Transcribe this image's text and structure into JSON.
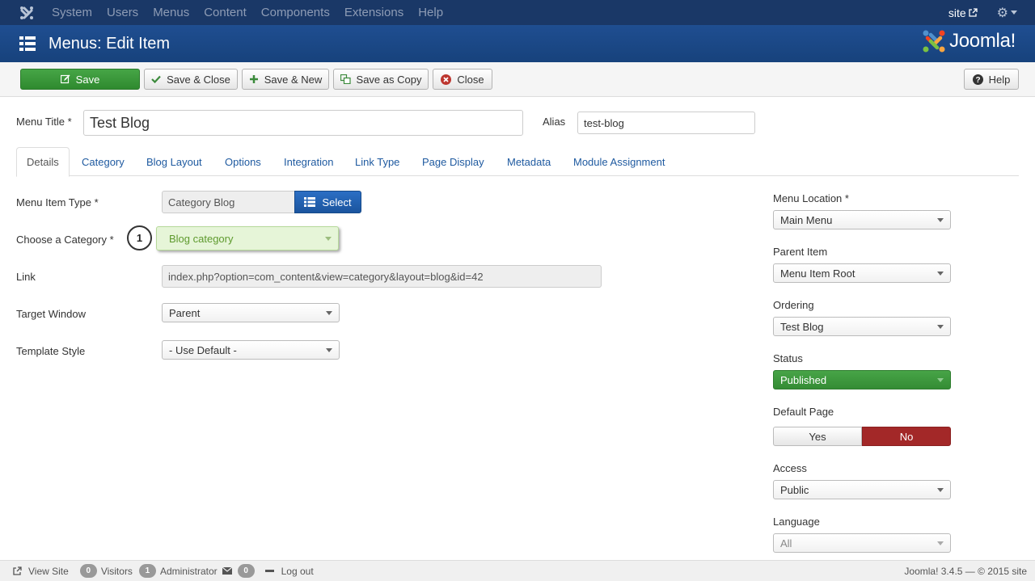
{
  "topnav": {
    "menu": [
      "System",
      "Users",
      "Menus",
      "Content",
      "Components",
      "Extensions",
      "Help"
    ],
    "site_label": "site"
  },
  "header": {
    "title": "Menus: Edit Item",
    "brand": "Joomla!"
  },
  "toolbar": {
    "save": "Save",
    "save_close": "Save & Close",
    "save_new": "Save & New",
    "save_copy": "Save as Copy",
    "close": "Close",
    "help": "Help"
  },
  "titlerow": {
    "menu_title_label": "Menu Title *",
    "menu_title_value": "Test Blog",
    "alias_label": "Alias",
    "alias_value": "test-blog"
  },
  "tabs": [
    "Details",
    "Category",
    "Blog Layout",
    "Options",
    "Integration",
    "Link Type",
    "Page Display",
    "Metadata",
    "Module Assignment"
  ],
  "details": {
    "menu_item_type_label": "Menu Item Type *",
    "menu_item_type_value": "Category Blog",
    "select_button": "Select",
    "category_label": "Choose a Category *",
    "category_value": "Blog category",
    "marker": "1",
    "link_label": "Link",
    "link_value": "index.php?option=com_content&view=category&layout=blog&id=42",
    "target_label": "Target Window",
    "target_value": "Parent",
    "template_label": "Template Style",
    "template_value": "- Use Default -"
  },
  "sidebar": {
    "menu_location_label": "Menu Location *",
    "menu_location_value": "Main Menu",
    "parent_label": "Parent Item",
    "parent_value": "Menu Item Root",
    "ordering_label": "Ordering",
    "ordering_value": "Test Blog",
    "status_label": "Status",
    "status_value": "Published",
    "default_label": "Default Page",
    "default_yes": "Yes",
    "default_no": "No",
    "access_label": "Access",
    "access_value": "Public",
    "language_label": "Language",
    "language_value": "All"
  },
  "footer": {
    "view_site": "View Site",
    "visitors_count": "0",
    "visitors_label": "Visitors",
    "admin_count": "1",
    "admin_label": "Administrator",
    "messages_count": "0",
    "logout": "Log out",
    "version": "Joomla! 3.4.5 — © 2015 site"
  },
  "colors": {
    "topnav": "#1a3867",
    "header": "#1f4d8f",
    "save_green": "#3b9a3b",
    "published_green": "#3f9b3f",
    "no_red": "#a32828",
    "link_blue": "#1f5aa0"
  }
}
